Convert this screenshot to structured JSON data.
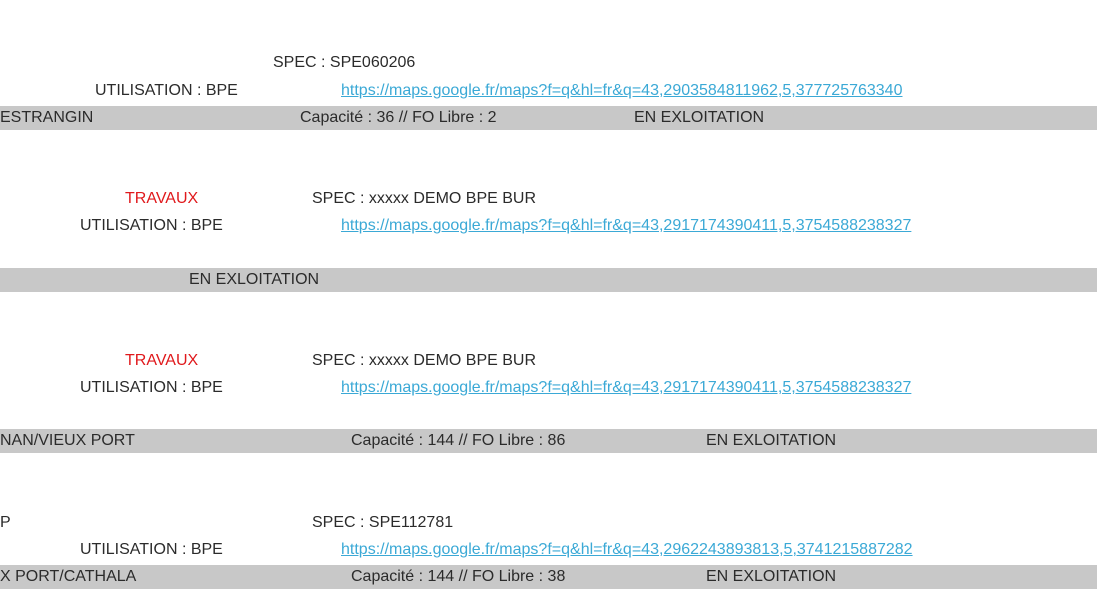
{
  "records": [
    {
      "status": "",
      "spec": "SPEC : SPE060206",
      "utilisation": "UTILISATION : BPE",
      "link": "https://maps.google.fr/maps?f=q&hl=fr&q=43,2903584811962,5,377725763340",
      "bar": {
        "name": "ESTRANGIN",
        "capacity": "Capacité : 36 // FO Libre : 2",
        "state": "EN EXLOITATION"
      }
    },
    {
      "status": "TRAVAUX",
      "spec": "SPEC : xxxxx DEMO BPE BUR",
      "utilisation": "UTILISATION : BPE",
      "link": "https://maps.google.fr/maps?f=q&hl=fr&q=43,2917174390411,5,3754588238327",
      "bar": {
        "name": "",
        "capacity": "",
        "state": "EN EXLOITATION"
      }
    },
    {
      "status": "TRAVAUX",
      "spec": "SPEC : xxxxx DEMO BPE BUR",
      "utilisation": "UTILISATION : BPE",
      "link": "https://maps.google.fr/maps?f=q&hl=fr&q=43,2917174390411,5,3754588238327",
      "bar": {
        "name": "NAN/VIEUX PORT",
        "capacity": "Capacité : 144 // FO Libre : 86",
        "state": "EN EXLOITATION"
      }
    },
    {
      "status": "P",
      "spec": "SPEC : SPE112781",
      "utilisation": "UTILISATION : BPE",
      "link": "https://maps.google.fr/maps?f=q&hl=fr&q=43,2962243893813,5,3741215887282",
      "bar": {
        "name": "X PORT/CATHALA",
        "capacity": "Capacité : 144 // FO Libre : 38",
        "state": "EN EXLOITATION"
      }
    }
  ]
}
